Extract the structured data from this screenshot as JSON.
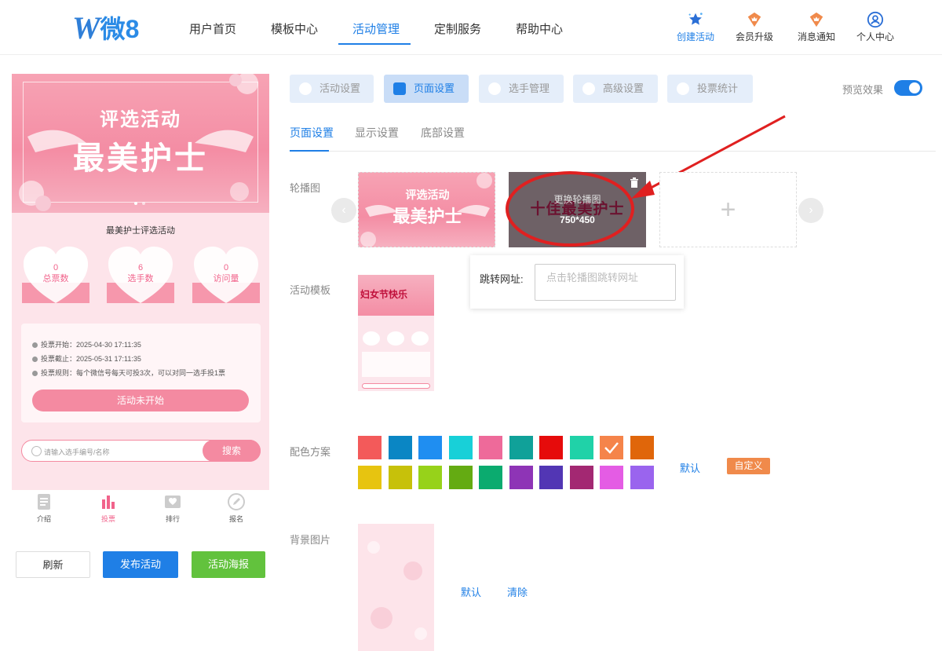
{
  "header": {
    "logo_w": "W",
    "logo_text": "微8",
    "nav": [
      "用户首页",
      "模板中心",
      "活动管理",
      "定制服务",
      "帮助中心"
    ],
    "active_nav": "活动管理",
    "icons": [
      {
        "name": "create-activity",
        "label": "创建活动",
        "icon": "star-icon"
      },
      {
        "name": "member-upgrade",
        "label": "会员升级",
        "icon": "crown-icon"
      },
      {
        "name": "notification",
        "label": "消息通知",
        "icon": "bell-icon"
      },
      {
        "name": "personal-center",
        "label": "个人中心",
        "icon": "user-icon"
      }
    ]
  },
  "preview": {
    "banner_title_small": "评选活动",
    "banner_title_large": "最美护士",
    "activity_name": "最美护士评选活动",
    "stats": [
      {
        "value": "0",
        "label": "总票数"
      },
      {
        "value": "6",
        "label": "选手数"
      },
      {
        "value": "0",
        "label": "访问量"
      }
    ],
    "info": [
      "投票开始：2025-04-30 17:11:35",
      "投票截止：2025-05-31 17:11:35",
      "投票规则：每个微信号每天可投3次，可以对同一选手投1票"
    ],
    "status_button": "活动未开始",
    "search_placeholder": "请输入选手编号/名称",
    "search_button": "搜索",
    "tabs": [
      {
        "label": "介绍",
        "icon": "document-icon"
      },
      {
        "label": "投票",
        "icon": "bar-chart-icon"
      },
      {
        "label": "排行",
        "icon": "ranking-icon"
      },
      {
        "label": "报名",
        "icon": "edit-icon"
      }
    ],
    "buttons": {
      "refresh": "刷新",
      "publish": "发布活动",
      "poster": "活动海报"
    }
  },
  "settings": {
    "top_tabs": [
      "活动设置",
      "页面设置",
      "选手管理",
      "高级设置",
      "投票统计"
    ],
    "active_top_tab": "页面设置",
    "preview_label": "预览效果",
    "preview_enabled": true,
    "sub_tabs": [
      "页面设置",
      "显示设置",
      "底部设置"
    ],
    "active_sub_tab": "页面设置",
    "carousel_label": "轮播图",
    "slide1_small": "评选活动",
    "slide1_large": "最美护士",
    "slide2_title": "十佳最美护士",
    "slide2_replace": "更换轮播图",
    "slide2_size": "750*450",
    "add_icon": "+",
    "jump_url_label": "跳转网址:",
    "jump_url_placeholder": "点击轮播图跳转网址",
    "template_label": "活动模板",
    "template_title": "妇女节快乐",
    "color_label": "配色方案",
    "colors": [
      "#f35a5a",
      "#0a86c4",
      "#1f8ef1",
      "#18d0d8",
      "#ee6a9a",
      "#10a199",
      "#e60b0b",
      "#20d2a8",
      "#f5844a",
      "#e0660a",
      "#e7c410",
      "#c7c10a",
      "#97d21a",
      "#64ab12",
      "#0bab6f",
      "#8e34b6",
      "#5236b4",
      "#a32872",
      "#e45ce4",
      "#9a64ee"
    ],
    "selected_color_index": 8,
    "color_default": "默认",
    "color_custom": "自定义",
    "bg_label": "背景图片",
    "bg_default": "默认",
    "bg_clear": "清除"
  }
}
